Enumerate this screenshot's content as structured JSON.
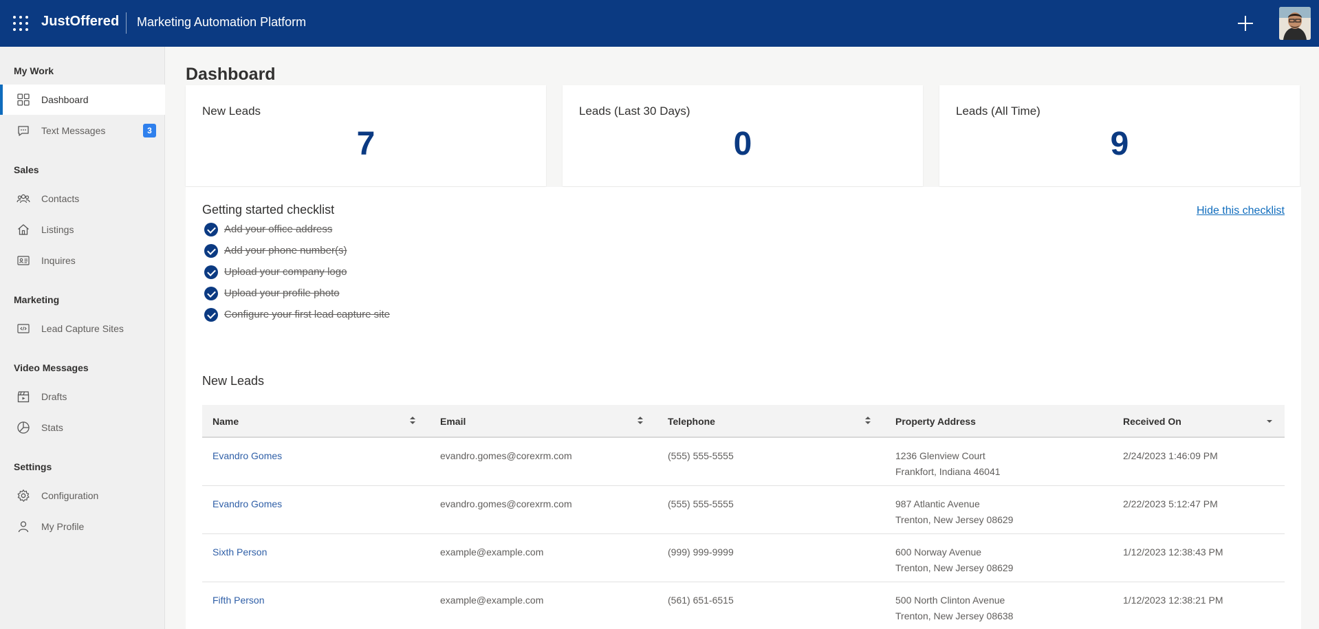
{
  "header": {
    "brand": "JustOffered",
    "app_title": "Marketing Automation Platform"
  },
  "sidebar": {
    "sections": [
      {
        "title": "My Work"
      },
      {
        "title": "Sales"
      },
      {
        "title": "Marketing"
      },
      {
        "title": "Video Messages"
      },
      {
        "title": "Settings"
      }
    ],
    "items": [
      {
        "label": "Dashboard",
        "icon": "dashboard-grid-icon",
        "active": true
      },
      {
        "label": "Text Messages",
        "icon": "chat-icon",
        "badge": "3"
      },
      {
        "label": "Contacts",
        "icon": "people-icon"
      },
      {
        "label": "Listings",
        "icon": "home-icon"
      },
      {
        "label": "Inquires",
        "icon": "contact-card-icon"
      },
      {
        "label": "Lead Capture Sites",
        "icon": "web-code-icon"
      },
      {
        "label": "Drafts",
        "icon": "clapperboard-icon"
      },
      {
        "label": "Stats",
        "icon": "pie-chart-icon"
      },
      {
        "label": "Configuration",
        "icon": "gear-icon"
      },
      {
        "label": "My Profile",
        "icon": "person-icon"
      }
    ]
  },
  "main": {
    "title": "Dashboard",
    "stats": [
      {
        "label": "New Leads",
        "value": "7"
      },
      {
        "label": "Leads (Last 30 Days)",
        "value": "0"
      },
      {
        "label": "Leads (All Time)",
        "value": "9"
      }
    ],
    "checklist": {
      "title": "Getting started checklist",
      "hide_label": "Hide this checklist",
      "items": [
        "Add your office address",
        "Add your phone number(s)",
        "Upload your company logo",
        "Upload your profile photo",
        "Configure your first lead capture site"
      ]
    },
    "leads": {
      "title": "New Leads",
      "columns": [
        "Name",
        "Email",
        "Telephone",
        "Property Address",
        "Received On"
      ],
      "rows": [
        {
          "name": "Evandro Gomes",
          "email": "evandro.gomes@corexrm.com",
          "phone": "(555) 555-5555",
          "address1": "1236 Glenview Court",
          "address2": "Frankfort, Indiana 46041",
          "received": "2/24/2023 1:46:09 PM"
        },
        {
          "name": "Evandro Gomes",
          "email": "evandro.gomes@corexrm.com",
          "phone": "(555) 555-5555",
          "address1": "987 Atlantic Avenue",
          "address2": "Trenton, New Jersey 08629",
          "received": "2/22/2023 5:12:47 PM"
        },
        {
          "name": "Sixth Person",
          "email": "example@example.com",
          "phone": "(999) 999-9999",
          "address1": "600 Norway Avenue",
          "address2": "Trenton, New Jersey 08629",
          "received": "1/12/2023 12:38:43 PM"
        },
        {
          "name": "Fifth Person",
          "email": "example@example.com",
          "phone": "(561) 651-6515",
          "address1": "500 North Clinton Avenue",
          "address2": "Trenton, New Jersey 08638",
          "received": "1/12/2023 12:38:21 PM"
        }
      ]
    }
  }
}
